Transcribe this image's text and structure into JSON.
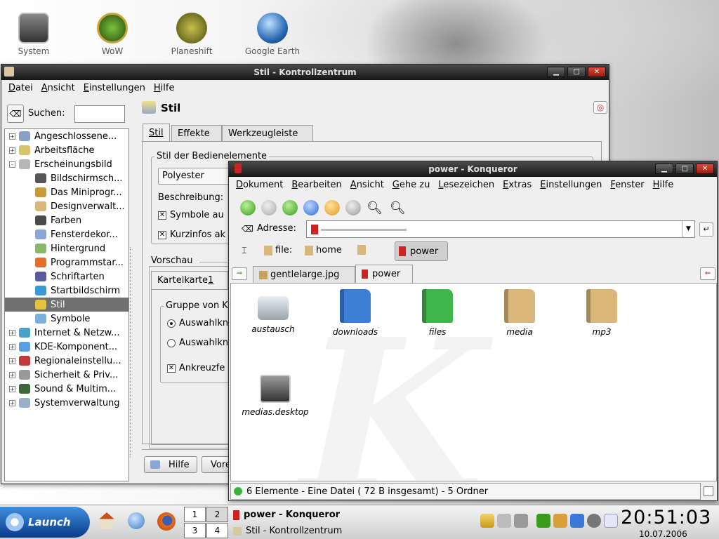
{
  "desktop": {
    "icons": [
      {
        "label": "System",
        "icon": "kde-computer-icon",
        "color": "#555555"
      },
      {
        "label": "WoW",
        "icon": "wow-icon",
        "color": "#3f7f1f"
      },
      {
        "label": "Planeshift",
        "icon": "planeshift-icon",
        "color": "#8a8a2a"
      },
      {
        "label": "Google Earth",
        "icon": "google-earth-icon",
        "color": "#2a6ab5"
      }
    ]
  },
  "control_center": {
    "title": "Stil - Kontrollzentrum",
    "menu": [
      "Datei",
      "Ansicht",
      "Einstellungen",
      "Hilfe"
    ],
    "search_label": "Suchen:",
    "search_value": "",
    "module_title": "Stil",
    "tree": [
      {
        "label": "Angeschlossene...",
        "expander": "+"
      },
      {
        "label": "Arbeitsfläche",
        "expander": "+"
      },
      {
        "label": "Erscheinungsbild",
        "expander": "-"
      },
      {
        "label": "Bildschirmsch...",
        "child": true
      },
      {
        "label": "Das Miniprogr...",
        "child": true
      },
      {
        "label": "Designverwalt...",
        "child": true
      },
      {
        "label": "Farben",
        "child": true
      },
      {
        "label": "Fensterdekor...",
        "child": true
      },
      {
        "label": "Hintergrund",
        "child": true
      },
      {
        "label": "Programmstar...",
        "child": true
      },
      {
        "label": "Schriftarten",
        "child": true
      },
      {
        "label": "Startbildschirm",
        "child": true
      },
      {
        "label": "Stil",
        "child": true,
        "selected": true
      },
      {
        "label": "Symbole",
        "child": true
      },
      {
        "label": "Internet & Netzw...",
        "expander": "+"
      },
      {
        "label": "KDE-Komponent...",
        "expander": "+"
      },
      {
        "label": "Regionaleinstellu...",
        "expander": "+"
      },
      {
        "label": "Sicherheit & Priv...",
        "expander": "+"
      },
      {
        "label": "Sound & Multim...",
        "expander": "+"
      },
      {
        "label": "Systemverwaltung",
        "expander": "+"
      }
    ],
    "tabs": [
      "Stil",
      "Effekte",
      "Werkzeugleiste"
    ],
    "group_elements": "Stil der Bedienelemente",
    "style_value": "Polyester",
    "beschreibung": "Beschreibung:",
    "check_symbole": "Symbole au",
    "check_kurzinfos": "Kurzinfos ak",
    "vorschau": "Vorschau",
    "preview_tab_label": "Karteikarte ",
    "preview_tab_num": "1",
    "preview_group": "Gruppe von K",
    "radio1": "Auswahlkn",
    "radio2": "Auswahlkn",
    "check_preview": "Ankreuzfe",
    "help_button": "Hilfe",
    "second_button": "Vore"
  },
  "konqueror": {
    "title": "power - Konqueror",
    "menu": [
      "Dokument",
      "Bearbeiten",
      "Ansicht",
      "Gehe zu",
      "Lesezeichen",
      "Extras",
      "Einstellungen",
      "Fenster",
      "Hilfe"
    ],
    "address_label": "Adresse:",
    "bookmarks": [
      "file:",
      "home",
      "power"
    ],
    "tabs": [
      "gentlelarge.jpg",
      "power"
    ],
    "files": [
      {
        "label": "austausch",
        "icon": "hard-drive-icon",
        "color": "#9aa4ad"
      },
      {
        "label": "downloads",
        "icon": "folder-blue-icon",
        "color": "#3d7fd6"
      },
      {
        "label": "files",
        "icon": "folder-green-icon",
        "color": "#3eb64a"
      },
      {
        "label": "media",
        "icon": "folder-beige-icon",
        "color": "#d9b77a"
      },
      {
        "label": "mp3",
        "icon": "folder-music-icon",
        "color": "#d9b77a"
      },
      {
        "label": "medias.desktop",
        "icon": "kde-computer-icon",
        "color": "#777777"
      }
    ],
    "status": "6 Elemente - Eine Datei ( 72 B insgesamt) - 5 Ordner"
  },
  "taskbar": {
    "launch": "Launch",
    "pager": [
      "1",
      "2",
      "3",
      "4"
    ],
    "tasks": [
      "power - Konqueror",
      "Stil - Kontrollzentrum"
    ],
    "clock": "20:51:03",
    "date": "10.07.2006"
  }
}
